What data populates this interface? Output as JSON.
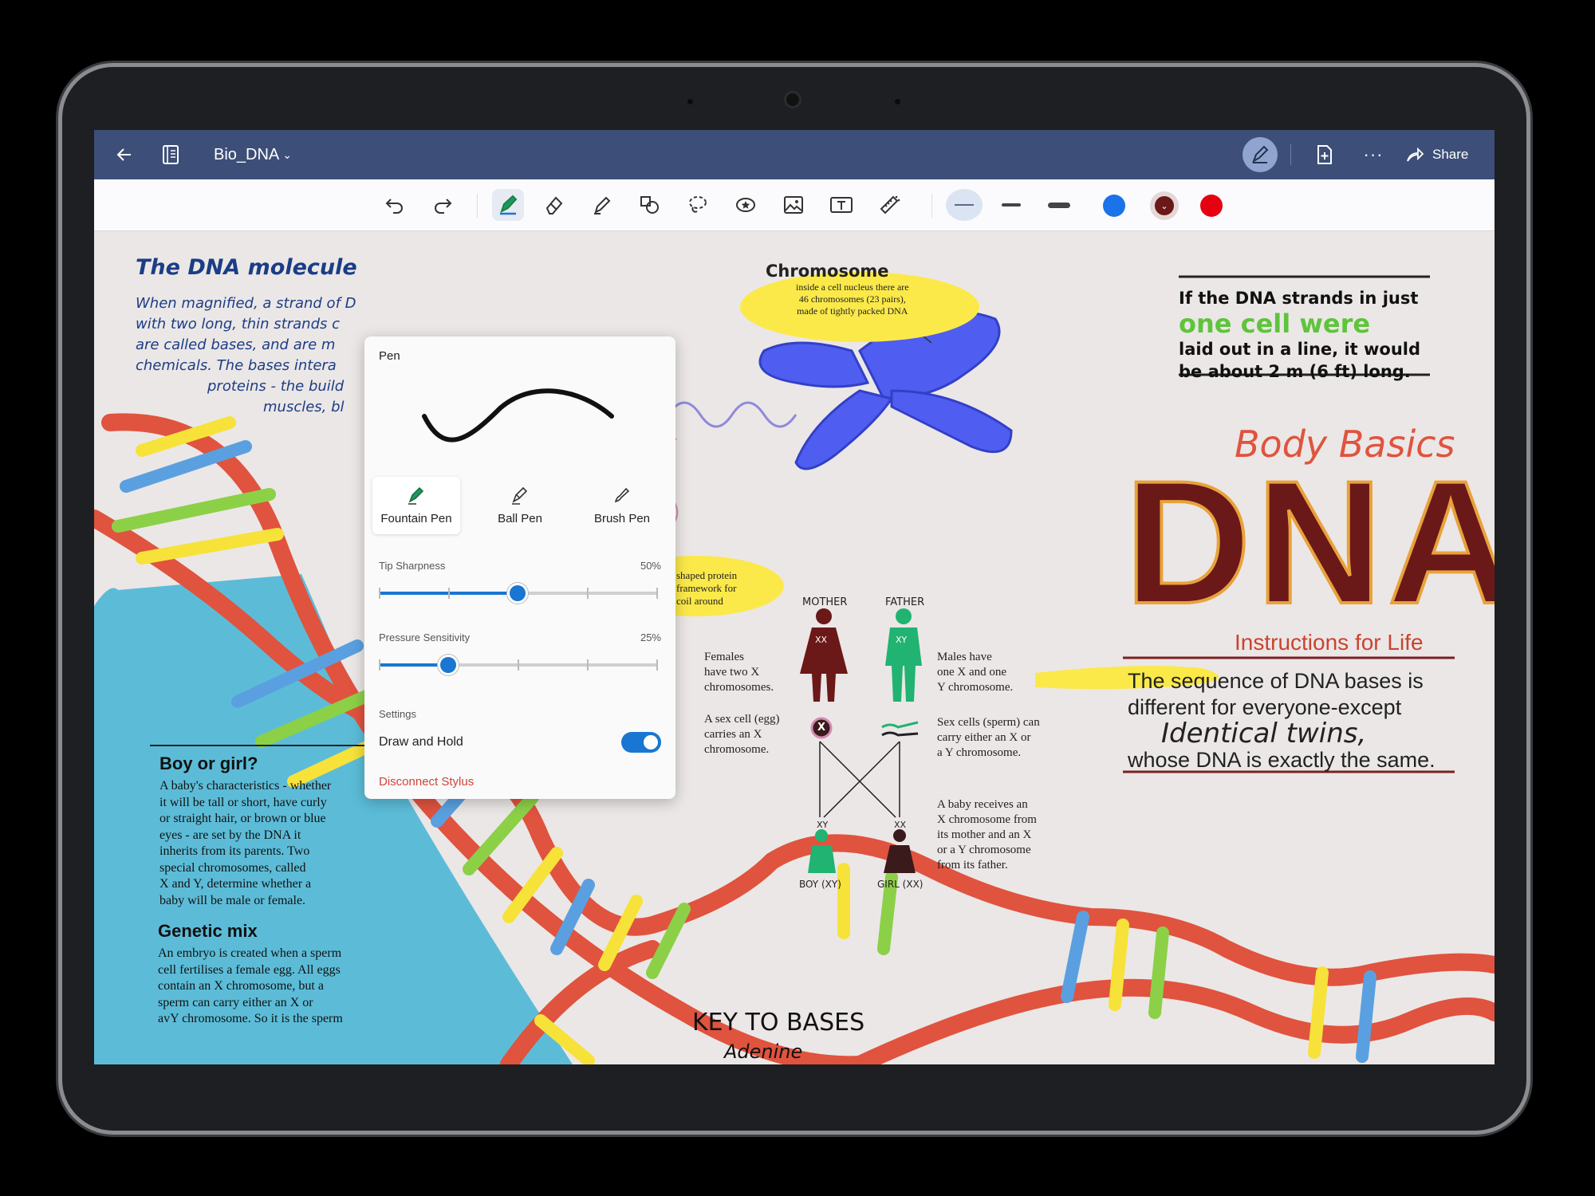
{
  "titlebar": {
    "title": "Bio_DNA",
    "share_label": "Share",
    "more_label": "···"
  },
  "toolbar": {
    "tools": [
      "undo-icon",
      "redo-icon",
      "pen-icon",
      "eraser-icon",
      "highlighter-icon",
      "shapes-icon",
      "lasso-icon",
      "sticker-icon",
      "image-icon",
      "text-box-icon",
      "ruler-icon"
    ],
    "colors": {
      "blue": "#1a73e8",
      "dark_red": "#6b1818",
      "red": "#e60012",
      "accent": "#1976d2"
    }
  },
  "pen_panel": {
    "title": "Pen",
    "pens": [
      {
        "label": "Fountain Pen",
        "icon": "fountain-pen-icon",
        "selected": true
      },
      {
        "label": "Ball Pen",
        "icon": "ball-pen-icon",
        "selected": false
      },
      {
        "label": "Brush Pen",
        "icon": "brush-pen-icon",
        "selected": false
      }
    ],
    "tip_sharpness": {
      "label": "Tip Sharpness",
      "value_text": "50%",
      "value": 0.5
    },
    "pressure_sensitivity": {
      "label": "Pressure Sensitivity",
      "value_text": "25%",
      "value": 0.25
    },
    "settings_label": "Settings",
    "draw_hold_label": "Draw and Hold",
    "draw_hold_on": true,
    "disconnect_label": "Disconnect Stylus"
  },
  "notes": {
    "dna_molecule_title": "The DNA molecule",
    "dna_molecule_lines": [
      "When magnified, a strand of D",
      "with two long, thin strands c",
      "are called bases, and are m",
      "chemicals. The bases intera",
      "proteins - the build",
      "muscles, bl"
    ],
    "chromosome_title": "Chromosome",
    "chromosome_text": [
      "inside a cell nucleus there are",
      "46 chromosomes (23 pairs),",
      "made of tightly packed DNA"
    ],
    "strands_lines": [
      "If the DNA strands in just",
      "laid out in a line, it would",
      "be about 2 m (6 ft) long."
    ],
    "strands_highlight": "one cell were",
    "body_basics": "Body Basics",
    "dna_big": "DNA",
    "instructions": "Instructions for Life",
    "sequence_lines": [
      "The sequence of DNA bases is",
      "different for everyone-except"
    ],
    "identical_twins": "Identical twins,",
    "sequence_end": "whose DNA is exactly the same.",
    "protein_text": [
      "shaped protein",
      "framework for",
      "coil around"
    ],
    "mother_label": "MOTHER",
    "father_label": "FATHER",
    "xx_label": "XX",
    "xy_label": "XY",
    "females_text": [
      "Females",
      "have two X",
      "chromosomes."
    ],
    "males_text": [
      "Males have",
      "one X and one",
      "Y chromosome."
    ],
    "egg_text": [
      "A sex cell (egg)",
      "carries an X",
      "chromosome."
    ],
    "sperm_text": [
      "Sex cells (sperm) can",
      "carry either an X or",
      "a Y chromosome."
    ],
    "baby_text": [
      "A baby receives an",
      "X chromosome from",
      "its mother and an X",
      "or a Y chromosome",
      "from its father."
    ],
    "x_mark": "X",
    "y_mark": "Y",
    "boy_label": "BOY (XY)",
    "girl_label": "GIRL (XX)",
    "boy_girl_title": "Boy or girl?",
    "boy_girl_text": [
      "A baby's characteristics - whether",
      "it will be tall or short, have curly",
      "or straight hair, or brown or blue",
      "eyes - are set by the DNA it",
      "inherits from its parents. Two",
      "special chromosomes, called",
      "X and Y, determine whether a",
      "baby will be male or female."
    ],
    "genetic_title": "Genetic mix",
    "genetic_text": [
      "An embryo is created when a sperm",
      "cell fertilises a female egg. All eggs",
      "contain an X chromosome, but a",
      "sperm can carry either an X or",
      "avY chromosome. So it is the sperm"
    ],
    "key_title": "KEY TO BASES",
    "key_first": "Adenine"
  }
}
